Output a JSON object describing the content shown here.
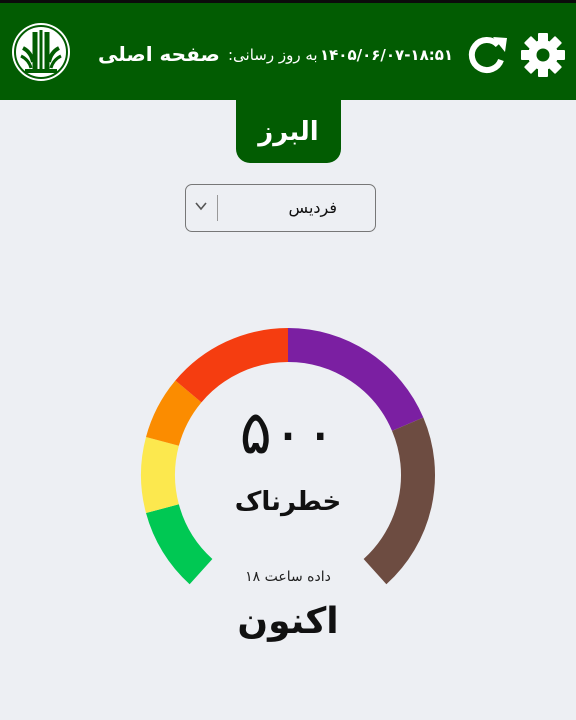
{
  "header": {
    "title": "صفحه اصلی",
    "update_label": "به روز رسانی:",
    "update_time": "۱۴۰۵/۰۶/۰۷-۱۸:۵۱",
    "refresh_icon": "refresh-icon",
    "settings_icon": "gear-icon",
    "logo_icon": "department-of-environment-logo"
  },
  "province": {
    "name": "البرز"
  },
  "city_select": {
    "selected": "فردیس"
  },
  "gauge": {
    "value": "۵۰۰",
    "status": "خطرناک",
    "data_hour": "داده ساعت ۱۸",
    "period": "اکنون",
    "level_fraction": 1.0,
    "segment_colors": [
      "#00c853",
      "#fce84e",
      "#fb8c00",
      "#f53d10",
      "#7b1fa2",
      "#6d4c41"
    ]
  },
  "colors": {
    "header_bg": "#025c02",
    "page_bg": "#edeff3"
  }
}
